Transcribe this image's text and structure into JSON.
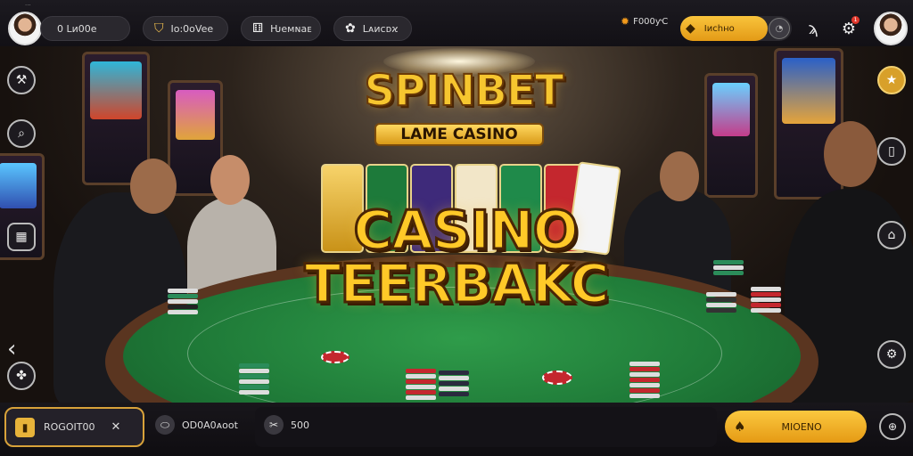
{
  "header": {
    "tiny_text": "...",
    "user_pill": "0 Lᴎ00e",
    "nav": [
      {
        "label": "Iᴏ:0oVee",
        "icon": "crest-icon"
      },
      {
        "label": "Ƕeᴍɴaᴇ",
        "icon": "dice-icon"
      },
      {
        "label": "Lᴀᴎcᴅϰ",
        "icon": "poker-chip-icon"
      }
    ],
    "balance": "F000ƴC",
    "deposit_label": "Iᴎchʜo",
    "notification_count": "1"
  },
  "scene": {
    "logo_title": "SPINBET",
    "logo_subtitle": "LAME CASINO",
    "headline_1": "CASINO",
    "headline_2": "TEERBAKC"
  },
  "bottom": {
    "wallet_label": "ROGOIT00",
    "item_1": "OD0A0ᴀoot",
    "item_2": "500",
    "play_label": "MIOENO"
  },
  "colors": {
    "accent_gold": "#f2b72e",
    "felt_green": "#1f7a38",
    "bar_bg": "#17151a"
  }
}
